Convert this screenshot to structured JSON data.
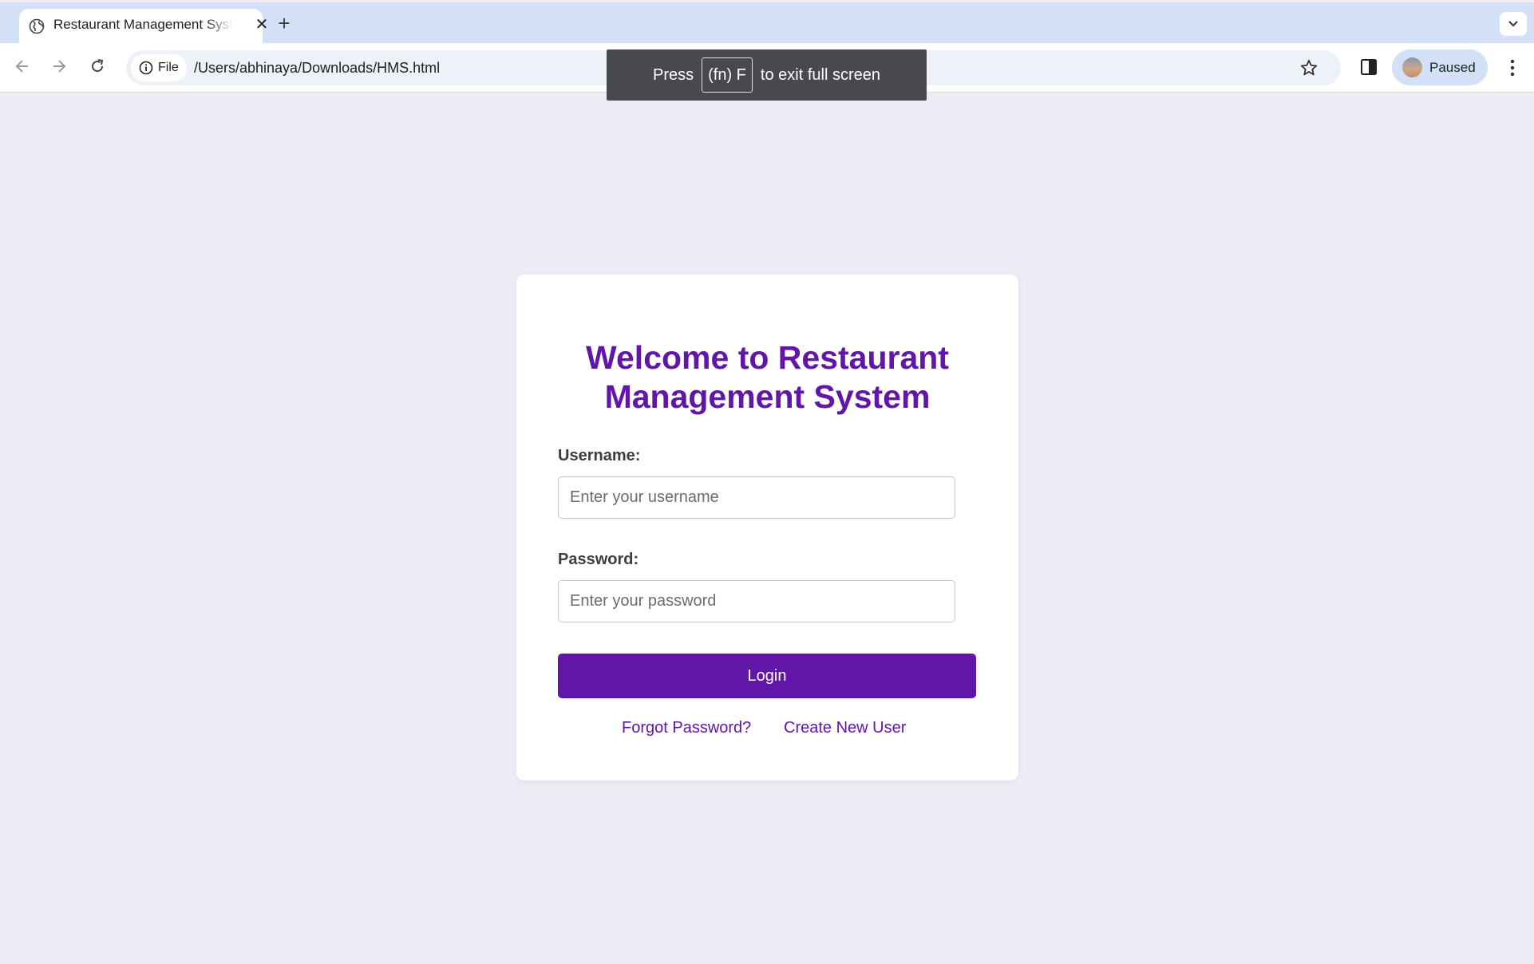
{
  "browser": {
    "tab": {
      "title": "Restaurant Management System",
      "close_glyph": "✕",
      "icon": "globe-icon"
    },
    "new_tab_glyph": "+",
    "toolbar": {
      "file_chip_label": "File",
      "url": "/Users/abhinaya/Downloads/HMS.html",
      "profile_label": "Paused"
    },
    "fullscreen_toast": {
      "prefix": "Press",
      "key": "(fn) F",
      "suffix": "to exit full screen"
    }
  },
  "login": {
    "title": "Welcome to Restaurant Management System",
    "username_label": "Username:",
    "username_placeholder": "Enter your username",
    "username_value": "",
    "password_label": "Password:",
    "password_placeholder": "Enter your password",
    "password_value": "",
    "login_button": "Login",
    "forgot_link": "Forgot Password?",
    "create_link": "Create New User"
  },
  "colors": {
    "accent": "#6116a8",
    "page_background": "#efecf6",
    "tabstrip": "#d3e1f8",
    "toast": "#47494d"
  }
}
